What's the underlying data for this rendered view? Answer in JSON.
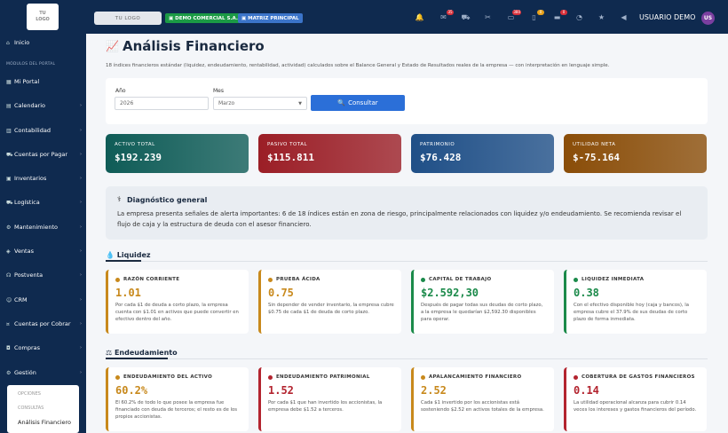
{
  "sidebar": {
    "logo": "TU\nLOGO",
    "inicio": "Inicio",
    "section_header": "MÓDULOS DEL PORTAL",
    "items": [
      {
        "label": "Mi Portal",
        "icon": "grid-icon"
      },
      {
        "label": "Calendario",
        "icon": "calendar-icon"
      },
      {
        "label": "Contabilidad",
        "icon": "book-icon"
      },
      {
        "label": "Cuentas por Pagar",
        "icon": "cart-icon"
      },
      {
        "label": "Inventarios",
        "icon": "box-icon"
      },
      {
        "label": "Logística",
        "icon": "truck-icon"
      },
      {
        "label": "Mantenimiento",
        "icon": "wrench-icon"
      },
      {
        "label": "Ventas",
        "icon": "tag-icon"
      },
      {
        "label": "Postventa",
        "icon": "headset-icon"
      },
      {
        "label": "CRM",
        "icon": "users-icon"
      },
      {
        "label": "Cuentas por Cobrar",
        "icon": "money-icon"
      },
      {
        "label": "Compras",
        "icon": "bag-icon"
      },
      {
        "label": "Gestión",
        "icon": "gear-icon"
      }
    ],
    "submenu": {
      "opciones": "OPCIONES",
      "consultas": "CONSULTAS",
      "active": "Análisis Financiero"
    }
  },
  "topbar": {
    "logo_text": "TU LOGO",
    "company": "DEMO COMERCIAL S.A.",
    "branch": "MATRIZ PRINCIPAL",
    "icons": [
      {
        "name": "bell-icon",
        "count": ""
      },
      {
        "name": "chat-icon",
        "count": "35"
      },
      {
        "name": "truck-icon",
        "count": ""
      },
      {
        "name": "tools-icon",
        "count": ""
      },
      {
        "name": "inbox-icon",
        "count": "380"
      },
      {
        "name": "file-icon",
        "count": "0"
      },
      {
        "name": "folder-icon",
        "count": "0"
      },
      {
        "name": "clock-icon",
        "count": ""
      },
      {
        "name": "star-icon",
        "count": ""
      },
      {
        "name": "megaphone-icon",
        "count": ""
      }
    ],
    "user": "USUARIO DEMO",
    "avatar": "US"
  },
  "page": {
    "title": "Análisis Financiero",
    "subtitle": "18 índices financieros estándar (liquidez, endeudamiento, rentabilidad, actividad) calculados sobre el Balance General y Estado de Resultados reales de la empresa — con interpretación en lenguaje simple."
  },
  "filter": {
    "year_label": "Año",
    "year_value": "2026",
    "month_label": "Mes",
    "month_value": "Marzo",
    "button": "Consultar"
  },
  "summary": [
    {
      "label": "ACTIVO TOTAL",
      "value": "$192.239",
      "color": "#0f5c57"
    },
    {
      "label": "PASIVO TOTAL",
      "value": "$115.811",
      "color": "#9b1e26"
    },
    {
      "label": "PATRIMONIO",
      "value": "$76.428",
      "color": "#1f4f87"
    },
    {
      "label": "UTILIDAD NETA",
      "value": "$-75.164",
      "color": "#8a4d08"
    }
  ],
  "diagnosis": {
    "title": "Diagnóstico general",
    "text": "La empresa presenta señales de alerta importantes: 6 de 18 índices están en zona de riesgo, principalmente relacionados con liquidez y/o endeudamiento. Se recomienda revisar el flujo de caja y la estructura de deuda con el asesor financiero."
  },
  "sections": {
    "liquidez": "Liquidez",
    "endeudamiento": "Endeudamiento"
  },
  "liquidez": [
    {
      "title": "RAZÓN CORRIENTE",
      "value": "1.01",
      "desc": "Por cada $1 de deuda a corto plazo, la empresa cuenta con $1.01 en activos que puede convertir en efectivo dentro del año.",
      "color": "#c8891c"
    },
    {
      "title": "PRUEBA ÁCIDA",
      "value": "0.75",
      "desc": "Sin depender de vender inventario, la empresa cubre $0.75 de cada $1 de deuda de corto plazo.",
      "color": "#c8891c"
    },
    {
      "title": "CAPITAL DE TRABAJO",
      "value": "$2.592,30",
      "desc": "Después de pagar todas sus deudas de corto plazo, a la empresa le quedarían $2,592.30 disponibles para operar.",
      "color": "#1b8a4a"
    },
    {
      "title": "LIQUIDEZ INMEDIATA",
      "value": "0.38",
      "desc": "Con el efectivo disponible hoy (caja y bancos), la empresa cubre el 37.9% de sus deudas de corto plazo de forma inmediata.",
      "color": "#1b8a4a"
    }
  ],
  "endeudamiento": [
    {
      "title": "ENDEUDAMIENTO DEL ACTIVO",
      "value": "60.2%",
      "desc": "El 60.2% de todo lo que posee la empresa fue financiado con deuda de terceros; el resto es de los propios accionistas.",
      "color": "#c8891c"
    },
    {
      "title": "ENDEUDAMIENTO PATRIMONIAL",
      "value": "1.52",
      "desc": "Por cada $1 que han invertido los accionistas, la empresa debe $1.52 a terceros.",
      "color": "#b3242f"
    },
    {
      "title": "APALANCAMIENTO FINANCIERO",
      "value": "2.52",
      "desc": "Cada $1 invertido por los accionistas está sosteniendo $2.52 en activos totales de la empresa.",
      "color": "#c8891c"
    },
    {
      "title": "COBERTURA DE GASTOS FINANCIEROS",
      "value": "0.14",
      "desc": "La utilidad operacional alcanza para cubrir 0.14 veces los intereses y gastos financieros del período.",
      "color": "#b3242f"
    }
  ]
}
